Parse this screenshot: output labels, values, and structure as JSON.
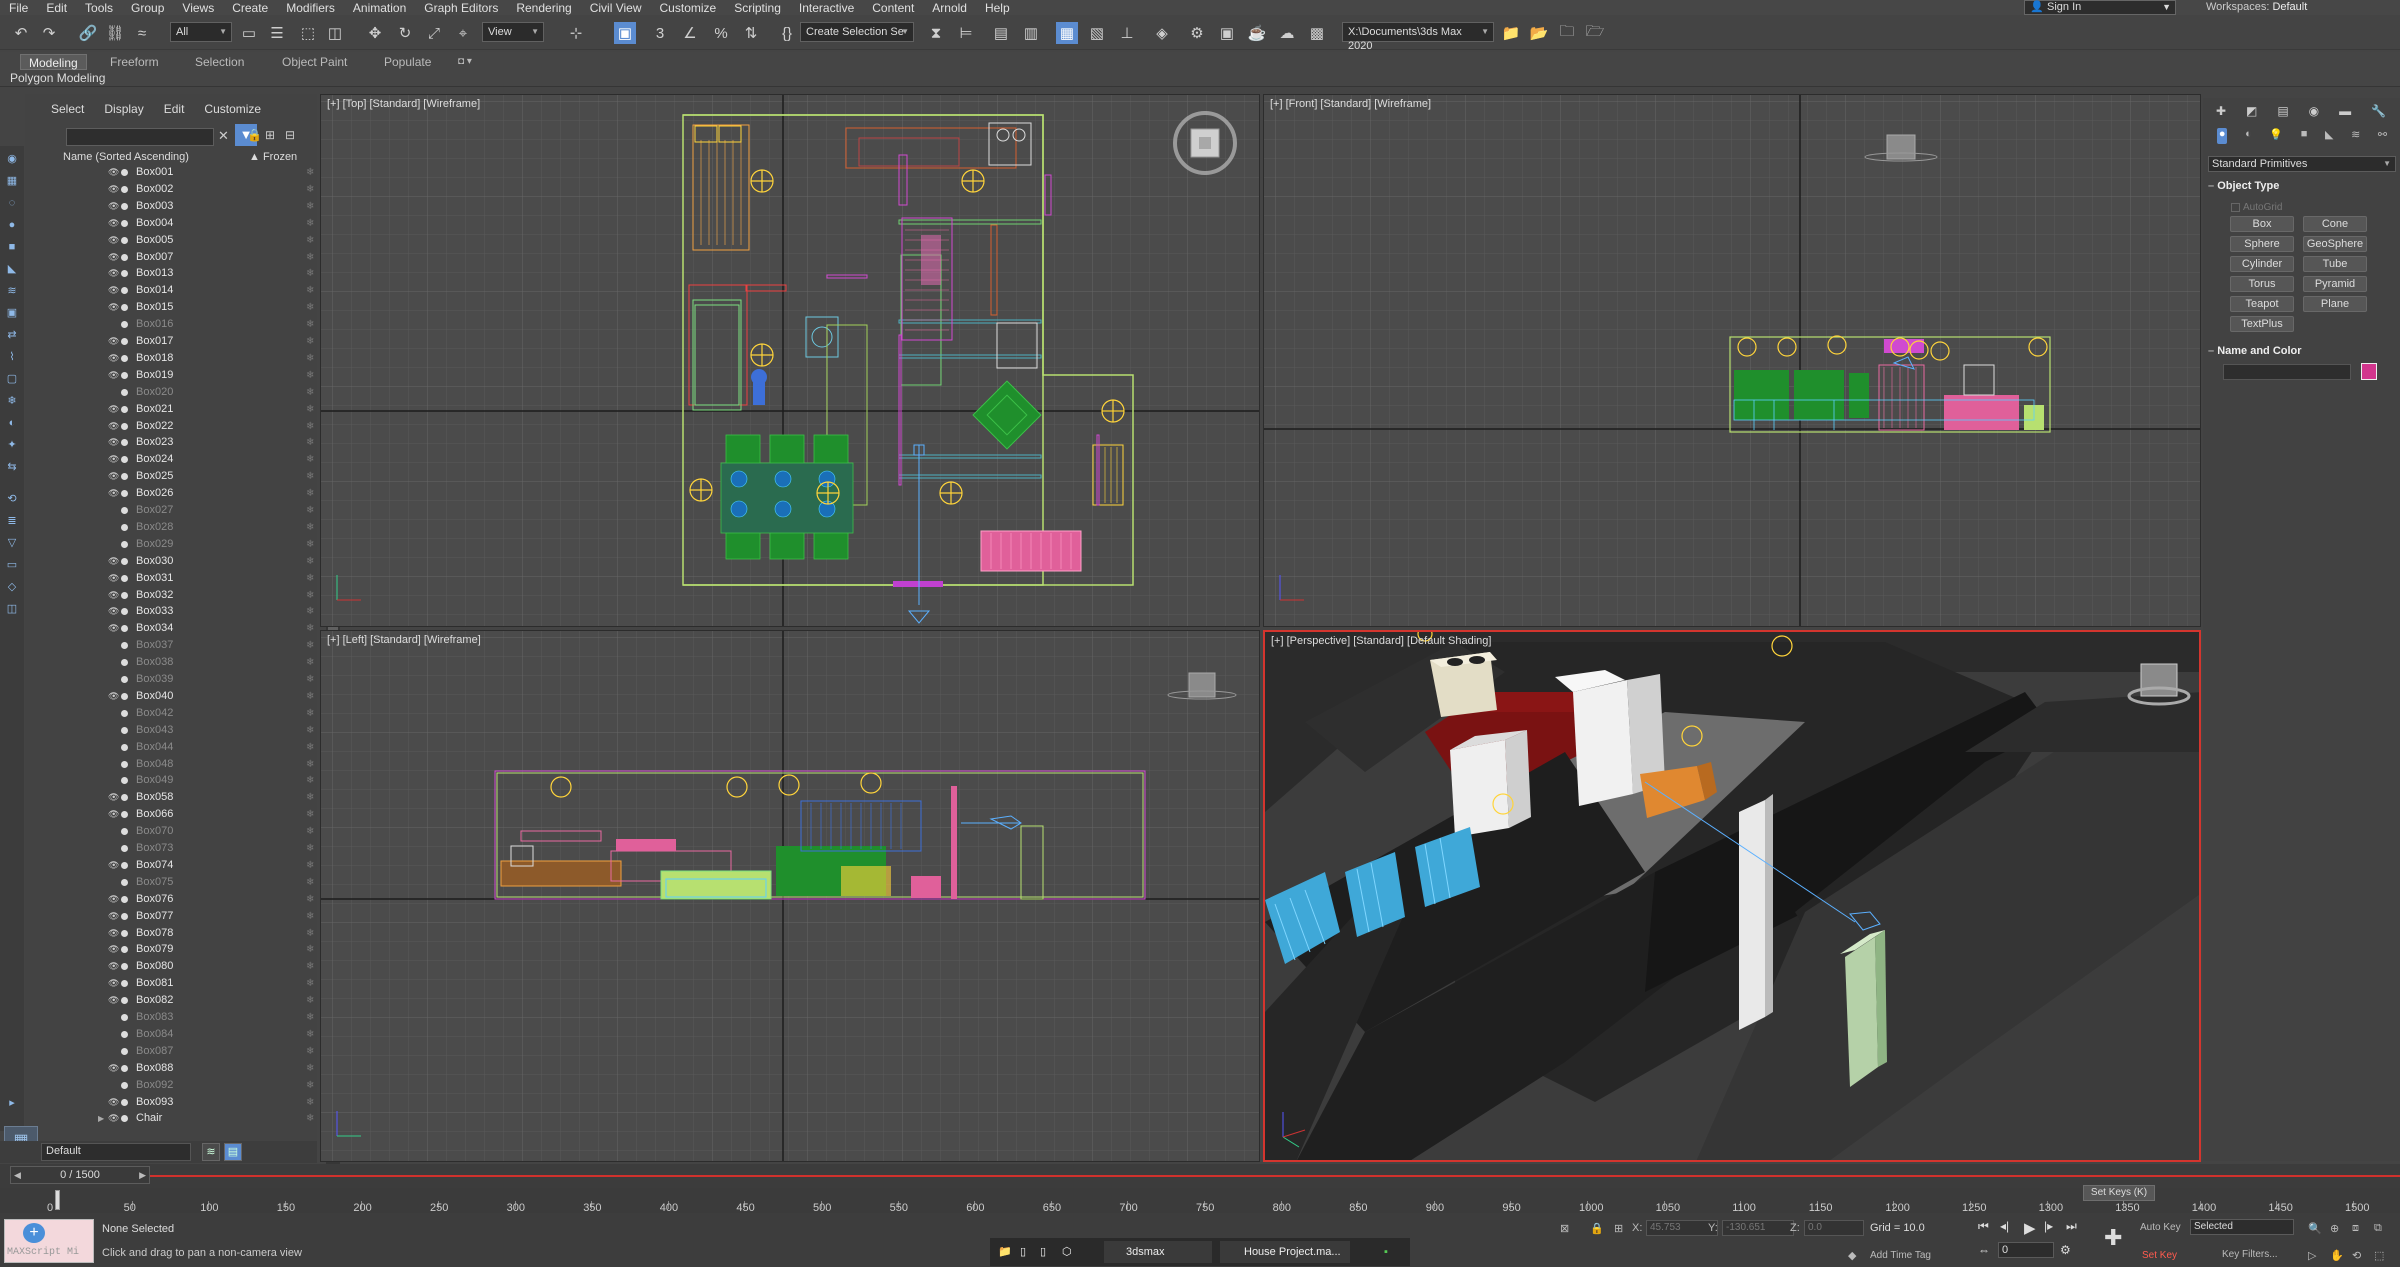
{
  "menu": [
    "File",
    "Edit",
    "Tools",
    "Group",
    "Views",
    "Create",
    "Modifiers",
    "Animation",
    "Graph Editors",
    "Rendering",
    "Civil View",
    "Customize",
    "Scripting",
    "Interactive",
    "Content",
    "Arnold",
    "Help"
  ],
  "account": {
    "sign_in": "Sign In",
    "workspace_label": "Workspaces:",
    "workspace_value": "Default"
  },
  "toolbar": {
    "filter_value": "All",
    "refcoord_value": "View",
    "selection_set_placeholder": "Create Selection Se",
    "project_path": "X:\\Documents\\3ds Max 2020"
  },
  "ribbon": {
    "tabs": [
      "Modeling",
      "Freeform",
      "Selection",
      "Object Paint",
      "Populate"
    ],
    "panel": "Polygon Modeling"
  },
  "scene_explorer": {
    "menu": [
      "Select",
      "Display",
      "Edit",
      "Customize"
    ],
    "column_name": "Name (Sorted Ascending)",
    "column_frozen": "▲ Frozen",
    "rows": [
      {
        "name": "Box001",
        "hidden": false
      },
      {
        "name": "Box002",
        "hidden": false
      },
      {
        "name": "Box003",
        "hidden": false
      },
      {
        "name": "Box004",
        "hidden": false
      },
      {
        "name": "Box005",
        "hidden": false
      },
      {
        "name": "Box007",
        "hidden": false
      },
      {
        "name": "Box013",
        "hidden": false
      },
      {
        "name": "Box014",
        "hidden": false
      },
      {
        "name": "Box015",
        "hidden": false
      },
      {
        "name": "Box016",
        "hidden": true
      },
      {
        "name": "Box017",
        "hidden": false
      },
      {
        "name": "Box018",
        "hidden": false
      },
      {
        "name": "Box019",
        "hidden": false
      },
      {
        "name": "Box020",
        "hidden": true
      },
      {
        "name": "Box021",
        "hidden": false
      },
      {
        "name": "Box022",
        "hidden": false
      },
      {
        "name": "Box023",
        "hidden": false
      },
      {
        "name": "Box024",
        "hidden": false
      },
      {
        "name": "Box025",
        "hidden": false
      },
      {
        "name": "Box026",
        "hidden": false
      },
      {
        "name": "Box027",
        "hidden": true
      },
      {
        "name": "Box028",
        "hidden": true
      },
      {
        "name": "Box029",
        "hidden": true
      },
      {
        "name": "Box030",
        "hidden": false
      },
      {
        "name": "Box031",
        "hidden": false
      },
      {
        "name": "Box032",
        "hidden": false
      },
      {
        "name": "Box033",
        "hidden": false
      },
      {
        "name": "Box034",
        "hidden": false
      },
      {
        "name": "Box037",
        "hidden": true
      },
      {
        "name": "Box038",
        "hidden": true
      },
      {
        "name": "Box039",
        "hidden": true
      },
      {
        "name": "Box040",
        "hidden": false
      },
      {
        "name": "Box042",
        "hidden": true
      },
      {
        "name": "Box043",
        "hidden": true
      },
      {
        "name": "Box044",
        "hidden": true
      },
      {
        "name": "Box048",
        "hidden": true
      },
      {
        "name": "Box049",
        "hidden": true
      },
      {
        "name": "Box058",
        "hidden": false
      },
      {
        "name": "Box066",
        "hidden": false
      },
      {
        "name": "Box070",
        "hidden": true
      },
      {
        "name": "Box073",
        "hidden": true
      },
      {
        "name": "Box074",
        "hidden": false
      },
      {
        "name": "Box075",
        "hidden": true
      },
      {
        "name": "Box076",
        "hidden": false
      },
      {
        "name": "Box077",
        "hidden": false
      },
      {
        "name": "Box078",
        "hidden": false
      },
      {
        "name": "Box079",
        "hidden": false
      },
      {
        "name": "Box080",
        "hidden": false
      },
      {
        "name": "Box081",
        "hidden": false
      },
      {
        "name": "Box082",
        "hidden": false
      },
      {
        "name": "Box083",
        "hidden": true
      },
      {
        "name": "Box084",
        "hidden": true
      },
      {
        "name": "Box087",
        "hidden": true
      },
      {
        "name": "Box088",
        "hidden": false
      },
      {
        "name": "Box092",
        "hidden": true
      },
      {
        "name": "Box093",
        "hidden": false
      },
      {
        "name": "Chair",
        "hidden": false
      }
    ],
    "layer": "Default"
  },
  "viewports": {
    "top": "[+] [Top] [Standard] [Wireframe]",
    "front": "[+] [Front] [Standard] [Wireframe]",
    "left": "[+] [Left] [Standard] [Wireframe]",
    "perspective": "[+] [Perspective] [Standard] [Default Shading]"
  },
  "command_panel": {
    "dropdown": "Standard Primitives",
    "object_type_title": "Object Type",
    "autogrid": "AutoGrid",
    "buttons": [
      "Box",
      "Cone",
      "Sphere",
      "GeoSphere",
      "Cylinder",
      "Tube",
      "Torus",
      "Pyramid",
      "Teapot",
      "Plane",
      "TextPlus"
    ],
    "name_color_title": "Name and Color",
    "color": "#d2358d"
  },
  "timeline": {
    "frame": "0 / 1500",
    "ticks": [
      "0",
      "50",
      "100",
      "150",
      "200",
      "250",
      "300",
      "350",
      "400",
      "450",
      "500",
      "550",
      "600",
      "650",
      "700",
      "750",
      "800",
      "850",
      "900",
      "950",
      "1000",
      "1050",
      "1100",
      "1150",
      "1200",
      "1250",
      "1300",
      "1350",
      "1400",
      "1450",
      "1500"
    ],
    "set_keys": "Set Keys"
  },
  "status": {
    "maxscript": "MAXScript Mi",
    "selection": "None Selected",
    "prompt": "Click and drag to pan a non-camera view",
    "x_label": "X:",
    "x_value": "45.753",
    "y_label": "Y:",
    "y_value": "-130.651",
    "z_label": "Z:",
    "z_value": "0.0",
    "grid": "Grid = 10.0",
    "add_time_tag": "Add Time Tag",
    "auto_key": "Auto Key",
    "selected": "Selected",
    "set_key": "Set Key",
    "key_filters": "Key Filters...",
    "current_frame": "0"
  },
  "taskbar": {
    "app": "3dsmax",
    "file": "House Project.ma..."
  }
}
